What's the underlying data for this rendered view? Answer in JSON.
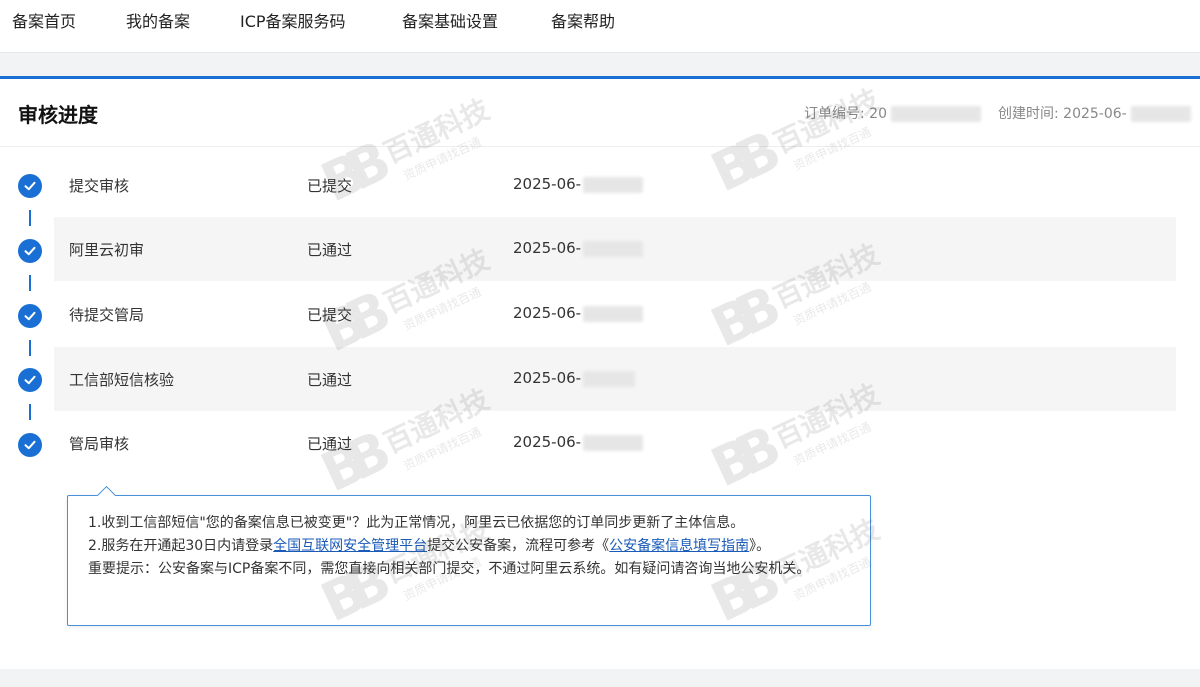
{
  "nav": {
    "items": [
      "备案首页",
      "我的备案",
      "ICP备案服务码",
      "备案基础设置",
      "备案帮助"
    ]
  },
  "header": {
    "title": "审核进度",
    "order_label": "订单编号: 20",
    "created_label": "创建时间: 2025-06-"
  },
  "steps": [
    {
      "name": "提交审核",
      "status": "已提交",
      "time": "2025-06-"
    },
    {
      "name": "阿里云初审",
      "status": "已通过",
      "time": "2025-06-"
    },
    {
      "name": "待提交管局",
      "status": "已提交",
      "time": "2025-06-"
    },
    {
      "name": "工信部短信核验",
      "status": "已通过",
      "time": "2025-06-"
    },
    {
      "name": "管局审核",
      "status": "已通过",
      "time": "2025-06-"
    }
  ],
  "notice": {
    "line1": "1.收到工信部短信\"您的备案信息已被变更\"？此为正常情况，阿里云已依据您的订单同步更新了主体信息。",
    "line2_prefix": "2.服务在开通起30日内请登录",
    "line2_link1": "全国互联网安全管理平台",
    "line2_mid": "提交公安备案，流程可参考《",
    "line2_link2": "公安备案信息填写指南",
    "line2_suffix": "》。",
    "line3": "重要提示：公安备案与ICP备案不同，需您直接向相关部门提交，不通过阿里云系统。如有疑问请咨询当地公安机关。"
  },
  "watermark": {
    "logo": "BB",
    "text": "百通科技",
    "sub": "资质申请找百通"
  },
  "colors": {
    "accent": "#1a6fd4",
    "link": "#1a5bb8"
  }
}
